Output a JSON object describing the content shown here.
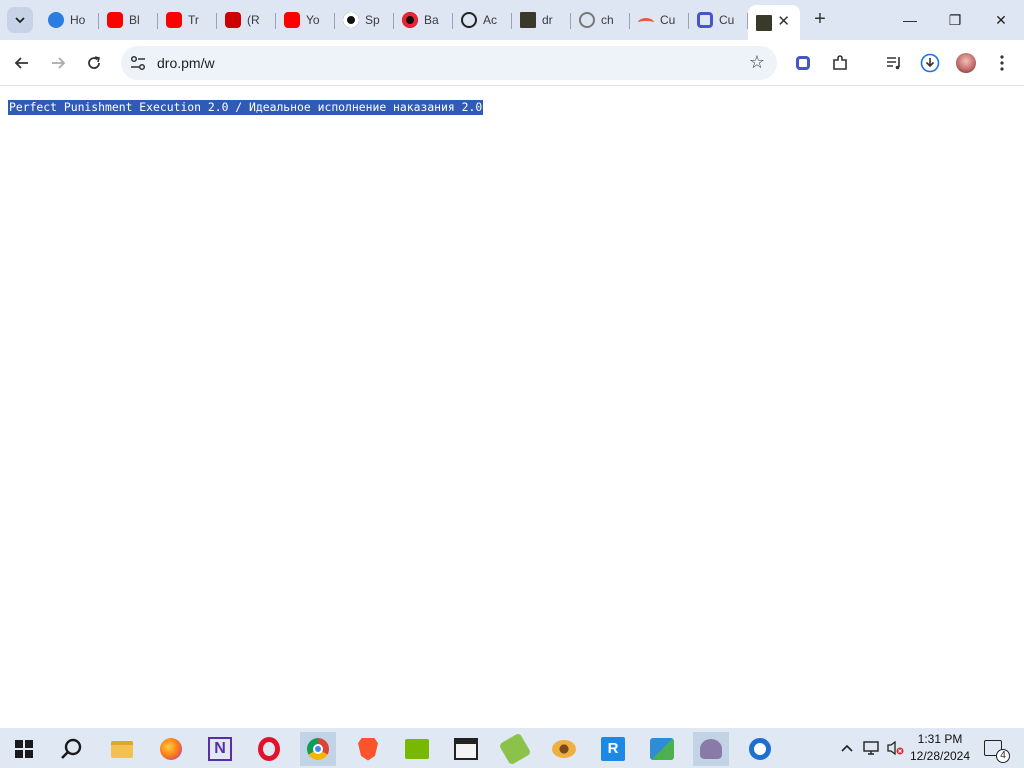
{
  "browser": {
    "tabs": [
      {
        "title": "Ho",
        "icon": "bird-icon",
        "color": "#2b7de0"
      },
      {
        "title": "Bl",
        "icon": "youtube-icon",
        "color": "#ff0000"
      },
      {
        "title": "Tr",
        "icon": "youtube-icon",
        "color": "#ff0000"
      },
      {
        "title": "(R",
        "icon": "youtube-icon",
        "color": "#cc0000"
      },
      {
        "title": "Yo",
        "icon": "youtube-icon",
        "color": "#ff0000"
      },
      {
        "title": "Sp",
        "icon": "spotify-like-icon",
        "color": "#111111"
      },
      {
        "title": "Ba",
        "icon": "record-icon",
        "color": "#111111"
      },
      {
        "title": "Ac",
        "icon": "openai-icon",
        "color": "#222222"
      },
      {
        "title": "dr",
        "icon": "site-favicon-icon",
        "color": "#3a3a2a"
      },
      {
        "title": "ch",
        "icon": "globe-icon",
        "color": "#777777"
      },
      {
        "title": "Cu",
        "icon": "rainbow-icon",
        "color": "#e0603a"
      },
      {
        "title": "Cu",
        "icon": "copilot-icon",
        "color": "#4656c7"
      }
    ],
    "active_tab": {
      "icon": "site-favicon-icon",
      "close": "✕"
    },
    "new_tab": "+",
    "window_controls": {
      "minimize": "—",
      "restore": "❐",
      "close": "✕"
    },
    "address": {
      "url": "dro.pm/w"
    },
    "accent": "#1a73e8"
  },
  "page": {
    "selected_text": "Perfect Punishment Execution 2.0 / Идеальное исполнение наказания 2.0",
    "selection_color": "#2f5bb7"
  },
  "taskbar": {
    "apps": [
      "start-icon",
      "search-icon",
      "file-explorer-icon",
      "firefox-icon",
      "onenote-like-icon",
      "opera-icon",
      "chrome-icon",
      "brave-icon",
      "nvidia-icon",
      "clapper-icon",
      "pea-icon",
      "eye-app-icon",
      "rs-app-icon",
      "network-app-icon",
      "ghost-app-icon",
      "edge-like-icon"
    ],
    "clock": {
      "time": "1:31 PM",
      "date": "12/28/2024"
    },
    "notifications_count": "4"
  }
}
